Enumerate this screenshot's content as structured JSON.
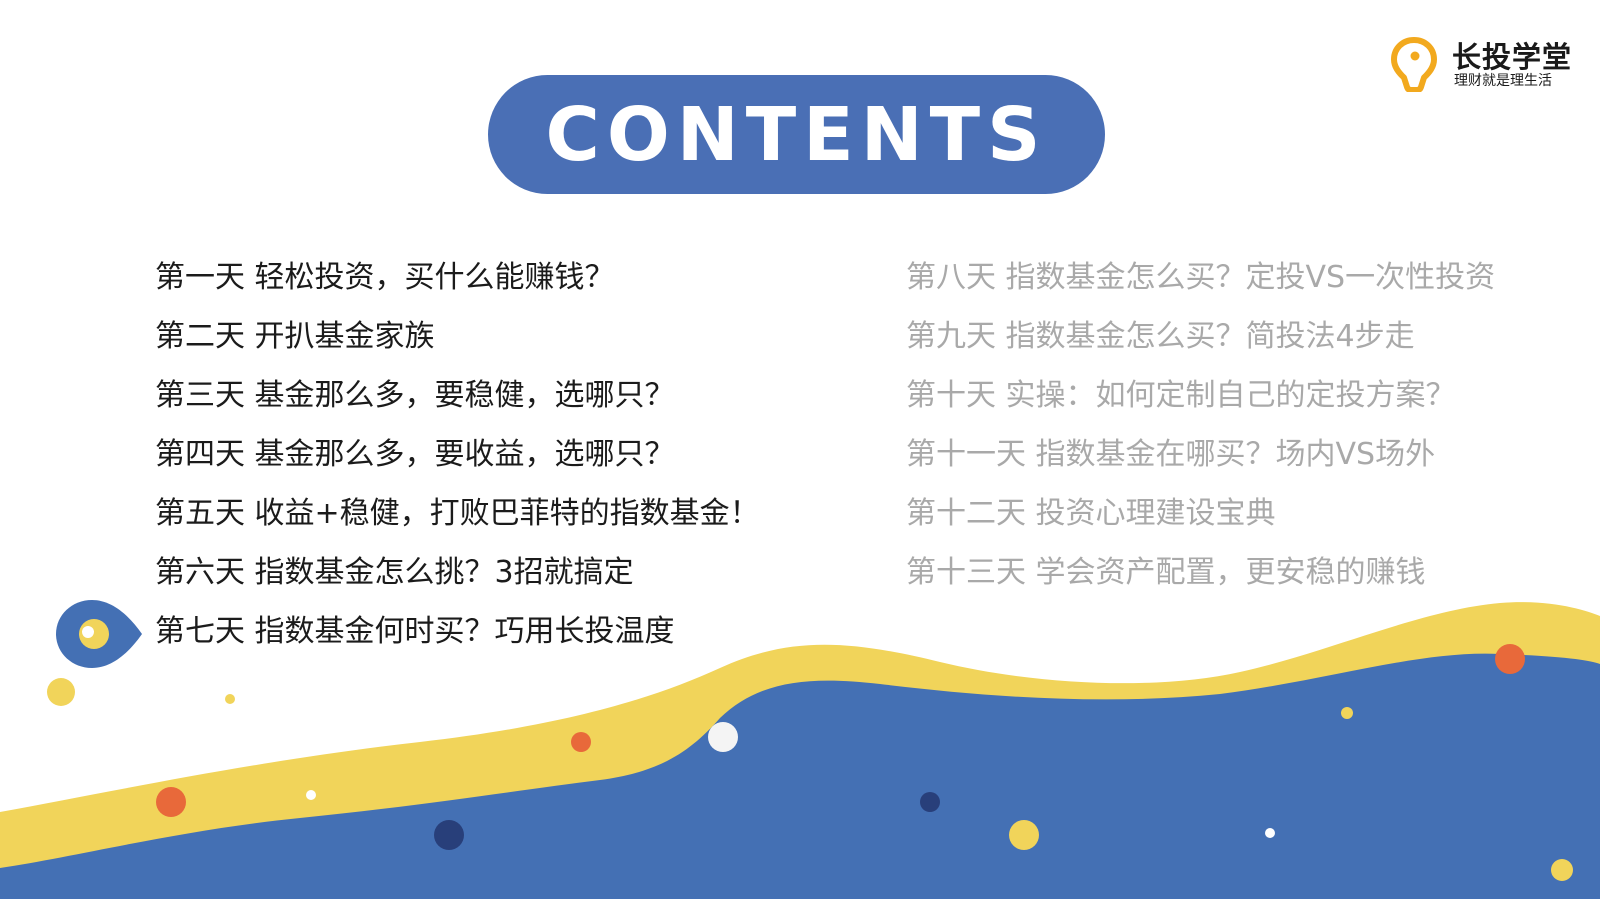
{
  "logo": {
    "name": "长投学堂",
    "slogan": "理财就是理生活",
    "colors": {
      "ring": "#f2a91e",
      "dot": "#f2a91e"
    }
  },
  "header": {
    "title": "CONTENTS"
  },
  "toc": {
    "left": [
      "第一天 轻松投资，买什么能赚钱？",
      "第二天 开扒基金家族",
      "第三天 基金那么多，要稳健，选哪只？",
      "第四天 基金那么多，要收益，选哪只？",
      "第五天 收益+稳健，打败巴菲特的指数基金！",
      "第六天 指数基金怎么挑？3招就搞定",
      "第七天 指数基金何时买？巧用长投温度"
    ],
    "right": [
      "第八天 指数基金怎么买？定投VS一次性投资",
      "第九天 指数基金怎么买？简投法4步走",
      "第十天 实操：如何定制自己的定投方案？",
      "第十一天 指数基金在哪买？场内VS场外",
      "第十二天 投资心理建设宝典",
      "第十三天 学会资产配置，更安稳的赚钱"
    ],
    "current_item": "第七天"
  },
  "colors": {
    "accent_blue": "#4a6fb5",
    "wave_yellow": "#f1d45a",
    "wave_blue": "#4470b4",
    "dot_orange": "#e8693a",
    "dot_navy": "#283f7a",
    "text_active": "#1b1b1b",
    "text_muted": "#a9a9a9"
  }
}
